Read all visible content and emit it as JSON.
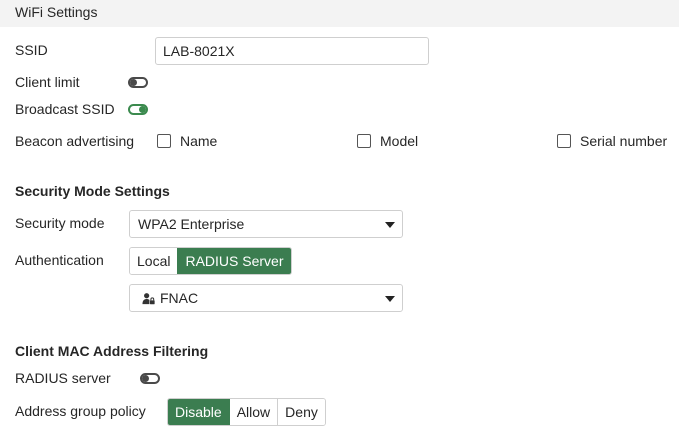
{
  "wifi": {
    "section_title": "WiFi Settings",
    "ssid": {
      "label": "SSID",
      "value": "LAB-8021X"
    },
    "client_limit": {
      "label": "Client limit",
      "enabled": false
    },
    "broadcast_ssid": {
      "label": "Broadcast SSID",
      "enabled": true
    },
    "beacon": {
      "label": "Beacon advertising",
      "options": [
        {
          "label": "Name",
          "checked": false
        },
        {
          "label": "Model",
          "checked": false
        },
        {
          "label": "Serial number",
          "checked": false
        }
      ]
    }
  },
  "security": {
    "section_title": "Security Mode Settings",
    "mode": {
      "label": "Security mode",
      "value": "WPA2 Enterprise"
    },
    "authentication": {
      "label": "Authentication",
      "options": [
        "Local",
        "RADIUS Server"
      ],
      "selected": "RADIUS Server"
    },
    "radius_server": {
      "value": "FNAC",
      "icon": "user-lock-icon"
    }
  },
  "mac_filter": {
    "section_title": "Client MAC Address Filtering",
    "radius_server": {
      "label": "RADIUS server",
      "enabled": false
    },
    "address_group_policy": {
      "label": "Address group policy",
      "options": [
        "Disable",
        "Allow",
        "Deny"
      ],
      "selected": "Disable"
    }
  },
  "colors": {
    "accent": "#3b7d50",
    "header_bg": "#f3f3f3",
    "border": "#cfcfcf"
  }
}
